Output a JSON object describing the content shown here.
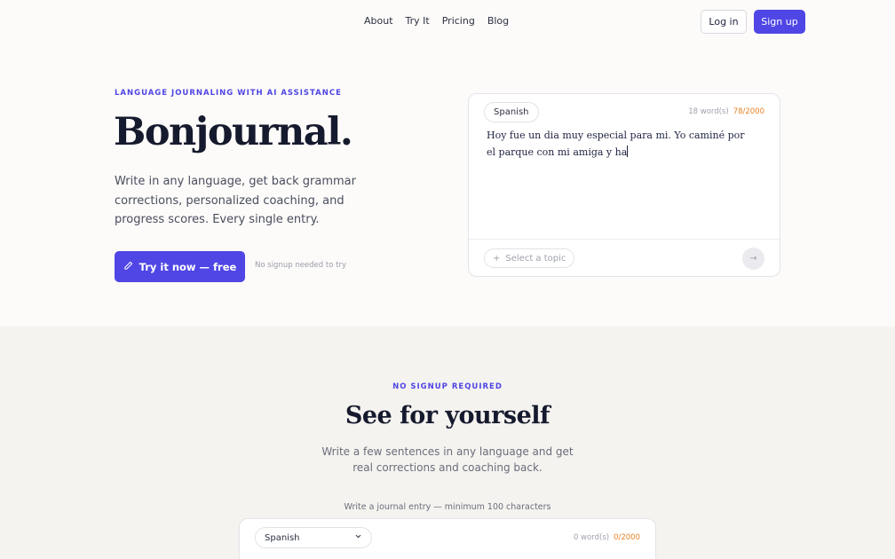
{
  "nav": {
    "links": [
      "About",
      "Try It",
      "Pricing",
      "Blog"
    ],
    "login_label": "Log in",
    "signup_label": "Sign up"
  },
  "hero": {
    "eyebrow": "LANGUAGE JOURNALING WITH AI ASSISTANCE",
    "title": "Bonjournal.",
    "description": "Write in any language, get back grammar corrections, personalized coaching, and progress scores. Every single entry.",
    "cta_label": "Try it now — free",
    "cta_note": "No signup needed to try"
  },
  "editor": {
    "language": "Spanish",
    "word_count": "18 word(s)",
    "char_count": "78/2000",
    "text": "Hoy fue un dia muy especial para mi. Yo caminé por el parque con mi amiga y ha",
    "topic_placeholder": "Select a topic"
  },
  "section2": {
    "eyebrow": "NO SIGNUP REQUIRED",
    "title": "See for yourself",
    "description": "Write a few sentences in any language and get real corrections and coaching back.",
    "hint": "Write a journal entry — minimum 100 characters",
    "language": "Spanish",
    "word_count": "0 word(s)",
    "char_count": "0/2000"
  },
  "colors": {
    "accent": "#4f46e5",
    "counter_warning": "#e8822a"
  }
}
